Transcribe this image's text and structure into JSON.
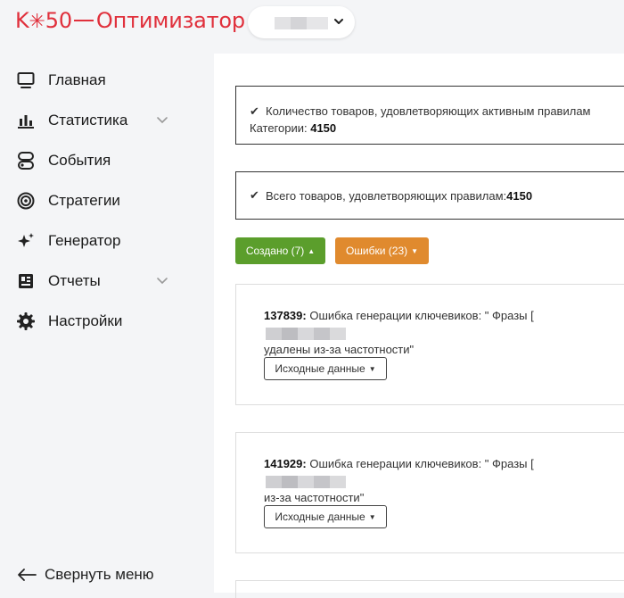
{
  "app": {
    "logo_prefix": "K",
    "logo_star": "✳",
    "logo_num": "50",
    "logo_name": "Оптимизатор",
    "brand_color": "#e0303c"
  },
  "sidebar": {
    "items": [
      {
        "label": "Главная",
        "icon": "monitor-icon",
        "expandable": false
      },
      {
        "label": "Статистика",
        "icon": "bar-chart-icon",
        "expandable": true
      },
      {
        "label": "События",
        "icon": "events-icon",
        "expandable": false
      },
      {
        "label": "Стратегии",
        "icon": "target-icon",
        "expandable": false
      },
      {
        "label": "Генератор",
        "icon": "sparkles-icon",
        "expandable": false
      },
      {
        "label": "Отчеты",
        "icon": "report-icon",
        "expandable": true
      },
      {
        "label": "Настройки",
        "icon": "gear-icon",
        "expandable": false
      }
    ],
    "collapse_label": "Свернуть меню"
  },
  "info": {
    "line1": "Количество товаров, удовлетворяющих активным правилам",
    "line2_label": "Категории: ",
    "line2_value": "4150",
    "total_label": "Всего товаров, удовлетворяющих правилам: ",
    "total_value": "4150"
  },
  "buttons": {
    "created": "Создано (7)",
    "errors": "Ошибки (23)",
    "created_color": "#5b9e2c",
    "errors_color": "#e08a2e"
  },
  "errors": [
    {
      "id": "137839:",
      "text_start": "Ошибка генерации ключевиков: \" Фразы [",
      "text_end": "удалены из-за частотности\"",
      "button": "Исходные данные"
    },
    {
      "id": "141929:",
      "text_start": "Ошибка генерации ключевиков: \" Фразы [",
      "text_end": "из-за частотности\"",
      "button": "Исходные данные"
    }
  ]
}
